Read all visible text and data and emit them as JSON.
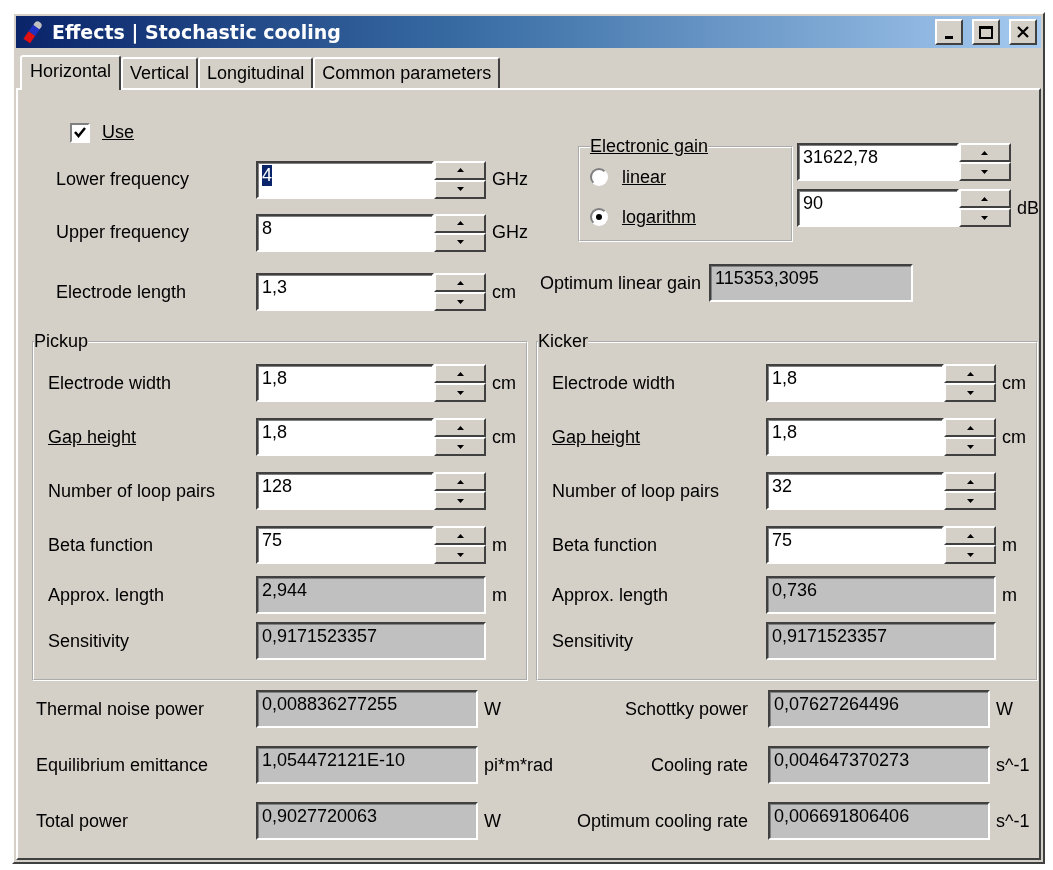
{
  "window": {
    "title": "Effects | Stochastic cooling"
  },
  "tabs": [
    {
      "label": "Horizontal",
      "selected": true
    },
    {
      "label": "Vertical",
      "selected": false
    },
    {
      "label": "Longitudinal",
      "selected": false
    },
    {
      "label": "Common parameters",
      "selected": false
    }
  ],
  "use": {
    "label": "Use",
    "checked": true
  },
  "fields": [
    {
      "label": "Lower frequency",
      "value": "4",
      "unit": "GHz",
      "text_selected": true
    },
    {
      "label": "Upper frequency",
      "value": "8",
      "unit": "GHz",
      "text_selected": false
    },
    {
      "label": "Electrode length",
      "value": "1,3",
      "unit": "cm",
      "text_selected": false
    }
  ],
  "electronic_gain": {
    "title": "Electronic gain",
    "options": [
      {
        "label": "linear",
        "selected": false
      },
      {
        "label": "logarithm",
        "selected": true
      }
    ],
    "fields": [
      {
        "value": "31622,78"
      },
      {
        "value": "90",
        "unit": "dB"
      }
    ],
    "optimum": {
      "label": "Optimum linear gain",
      "value": "115353,3095"
    }
  },
  "groups": [
    {
      "title": "Pickup",
      "rows": [
        {
          "kind": "spin",
          "label": "Electrode width",
          "value": "1,8",
          "unit": "cm",
          "underlined": false
        },
        {
          "kind": "spin",
          "label": "Gap height",
          "value": "1,8",
          "unit": "cm",
          "underlined": true
        },
        {
          "kind": "spin",
          "label": "Number of loop pairs",
          "value": "128",
          "underlined": false
        },
        {
          "kind": "spin",
          "label": "Beta function",
          "value": "75",
          "unit": "m",
          "underlined": false
        },
        {
          "kind": "readonly",
          "label": "Approx. length",
          "value": "2,944",
          "unit": "m",
          "underlined": false
        },
        {
          "kind": "readonly",
          "label": "Sensitivity",
          "value": "0,9171523357",
          "underlined": false
        }
      ]
    },
    {
      "title": "Kicker",
      "rows": [
        {
          "kind": "spin",
          "label": "Electrode width",
          "value": "1,8",
          "unit": "cm",
          "underlined": false
        },
        {
          "kind": "spin",
          "label": "Gap height",
          "value": "1,8",
          "unit": "cm",
          "underlined": true
        },
        {
          "kind": "spin",
          "label": "Number of loop pairs",
          "value": "32",
          "underlined": false
        },
        {
          "kind": "spin",
          "label": "Beta function",
          "value": "75",
          "unit": "m",
          "underlined": false
        },
        {
          "kind": "readonly",
          "label": "Approx. length",
          "value": "0,736",
          "unit": "m",
          "underlined": false
        },
        {
          "kind": "readonly",
          "label": "Sensitivity",
          "value": "0,9171523357",
          "underlined": false
        }
      ]
    }
  ],
  "results": [
    {
      "label": "Thermal noise power",
      "value": "0,008836277255",
      "unit": "W"
    },
    {
      "label": "Schottky power",
      "value": "0,07627264496",
      "unit": "W"
    },
    {
      "label": "Equilibrium emittance",
      "value": "1,054472121E-10",
      "unit": "pi*m*rad"
    },
    {
      "label": "Cooling rate",
      "value": "0,004647370273",
      "unit": "s^-1"
    },
    {
      "label": "Total power",
      "value": "0,9027720063",
      "unit": "W"
    },
    {
      "label": "Optimum cooling rate",
      "value": "0,006691806406",
      "unit": "s^-1"
    }
  ]
}
